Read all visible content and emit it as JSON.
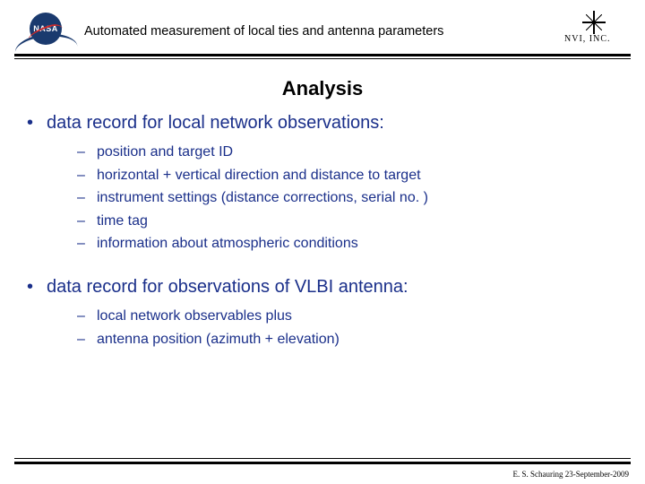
{
  "header": {
    "nasa_text": "NASA",
    "title": "Automated measurement of local ties and antenna parameters",
    "nvi_text": "NVI, INC."
  },
  "section_title": "Analysis",
  "bullets": [
    {
      "text": "data record for local network observations:",
      "sub": [
        "position and target ID",
        "horizontal + vertical direction and distance to target",
        "instrument settings (distance corrections, serial no. )",
        "time tag",
        "information about atmospheric conditions"
      ]
    },
    {
      "text": "data record for observations of VLBI antenna:",
      "sub": [
        "local network observables plus",
        "antenna position (azimuth + elevation)"
      ]
    }
  ],
  "footer": "E. S. Schauring 23-September-2009"
}
